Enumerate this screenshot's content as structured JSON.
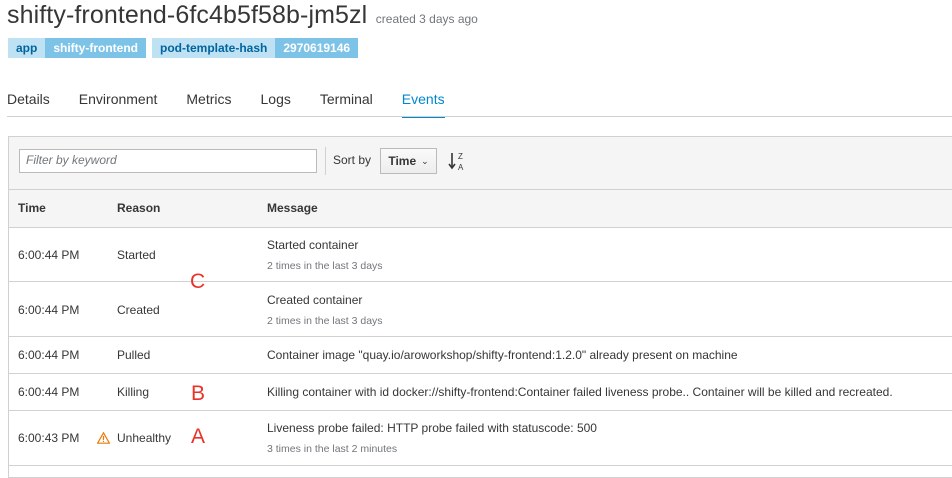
{
  "pod": {
    "name": "shifty-frontend-6fc4b5f58b-jm5zl",
    "created": "created 3 days ago"
  },
  "labels": [
    {
      "key": "app",
      "value": "shifty-frontend"
    },
    {
      "key": "pod-template-hash",
      "value": "2970619146"
    }
  ],
  "tabs": [
    "Details",
    "Environment",
    "Metrics",
    "Logs",
    "Terminal",
    "Events"
  ],
  "active_tab": "Events",
  "toolbar": {
    "filter_placeholder": "Filter by keyword",
    "sort_label": "Sort by",
    "sort_value": "Time",
    "sort_direction_icon": "sort-alpha-desc-icon"
  },
  "table": {
    "columns": [
      "Time",
      "Reason",
      "Message"
    ],
    "rows": [
      {
        "time": "6:00:44 PM",
        "reason": "Started",
        "message": "Started container",
        "sub": "2 times in the last 3 days",
        "warning": false
      },
      {
        "time": "6:00:44 PM",
        "reason": "Created",
        "message": "Created container",
        "sub": "2 times in the last 3 days",
        "warning": false
      },
      {
        "time": "6:00:44 PM",
        "reason": "Pulled",
        "message": "Container image \"quay.io/aroworkshop/shifty-frontend:1.2.0\" already present on machine",
        "sub": "",
        "warning": false
      },
      {
        "time": "6:00:44 PM",
        "reason": "Killing",
        "message": "Killing container with id docker://shifty-frontend:Container failed liveness probe.. Container will be killed and recreated.",
        "sub": "",
        "warning": false
      },
      {
        "time": "6:00:43 PM",
        "reason": "Unhealthy",
        "message": "Liveness probe failed: HTTP probe failed with statuscode: 500",
        "sub": "3 times in the last 2 minutes",
        "warning": true
      }
    ]
  },
  "annotations": {
    "a": "A",
    "b": "B",
    "c": "C"
  },
  "colors": {
    "accent": "#0088ce",
    "annotation": "#e8332a",
    "warning": "#ec7a08"
  }
}
